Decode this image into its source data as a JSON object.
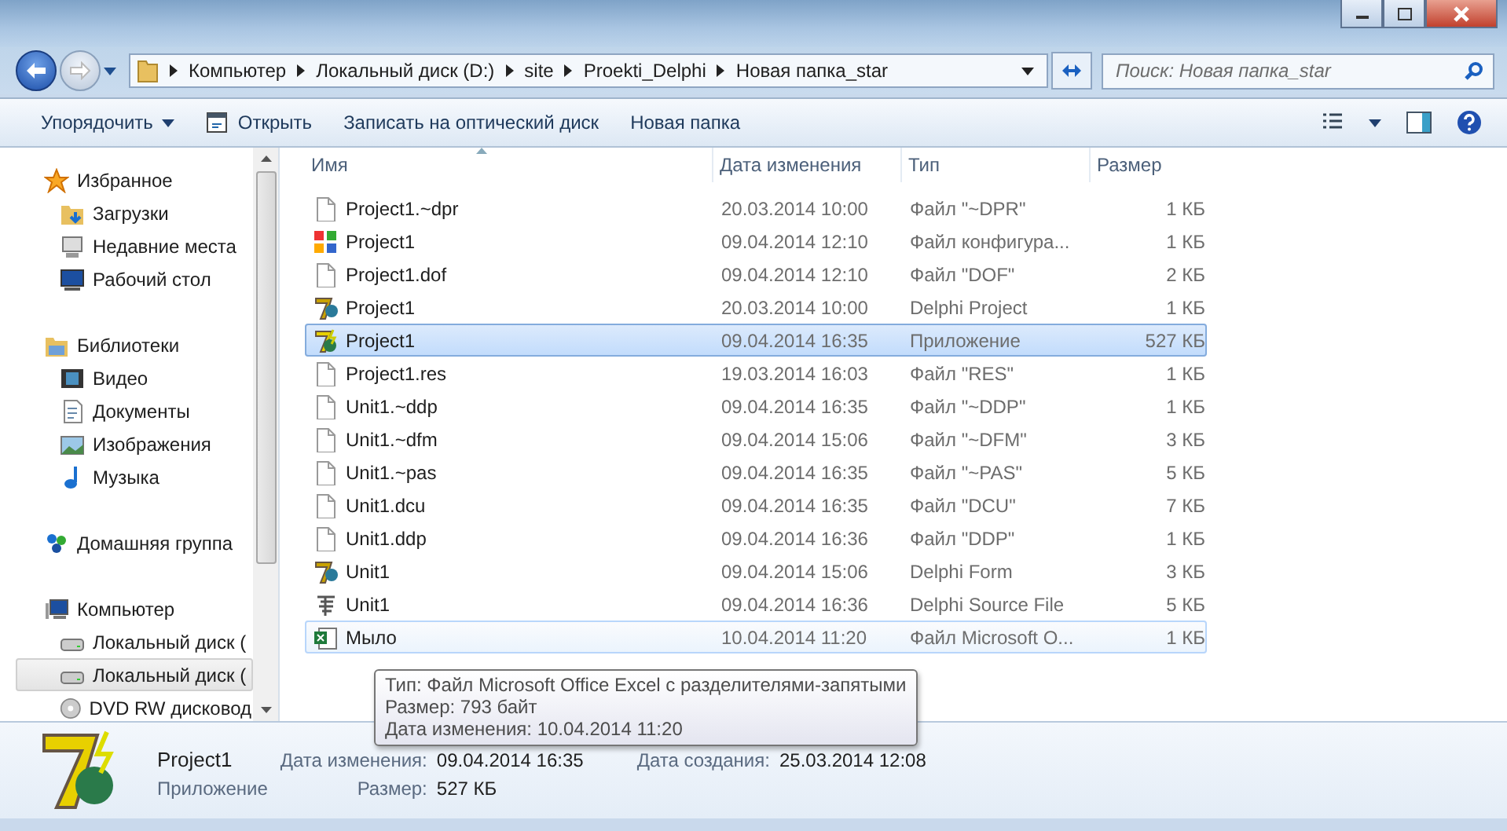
{
  "address_bar": {
    "crumbs": [
      "Компьютер",
      "Локальный диск (D:)",
      "site",
      "Proekti_Delphi",
      "Новая папка_star"
    ]
  },
  "search": {
    "placeholder": "Поиск: Новая папка_star"
  },
  "toolbar": {
    "buttons": [
      {
        "label": "Упорядочить",
        "kind": "menu"
      },
      {
        "label": "Открыть",
        "kind": "icon"
      },
      {
        "label": "Записать на оптический диск",
        "kind": "plain"
      },
      {
        "label": "Новая папка",
        "kind": "plain"
      }
    ]
  },
  "sidebar": {
    "groups": [
      {
        "label": "Избранное",
        "kind": "star",
        "selected": false,
        "children": [
          {
            "label": "Загрузки",
            "kind": "downloads",
            "selected": false
          },
          {
            "label": "Недавние места",
            "kind": "recent",
            "selected": false
          },
          {
            "label": "Рабочий стол",
            "kind": "desktop",
            "selected": false
          }
        ]
      },
      {
        "label": "Библиотеки",
        "kind": "library",
        "selected": false,
        "children": [
          {
            "label": "Видео",
            "kind": "video",
            "selected": false
          },
          {
            "label": "Документы",
            "kind": "document",
            "selected": false
          },
          {
            "label": "Изображения",
            "kind": "image",
            "selected": false
          },
          {
            "label": "Музыка",
            "kind": "music",
            "selected": false
          }
        ]
      },
      {
        "label": "Домашняя группа",
        "kind": "homegroup",
        "selected": false
      },
      {
        "label": "Компьютер",
        "kind": "computer",
        "selected": false,
        "children": [
          {
            "label": "Локальный диск (",
            "kind": "drive",
            "selected": false
          },
          {
            "label": "Локальный диск (",
            "kind": "drive",
            "selected": true
          },
          {
            "label": "DVD RW дисковод",
            "kind": "dvd",
            "selected": false
          }
        ]
      }
    ]
  },
  "table": {
    "columns": [
      "Имя",
      "Дата изменения",
      "Тип",
      "Размер"
    ],
    "rows": [
      {
        "name": "Project1.~dpr",
        "date": "20.03.2014 10:00",
        "type": "Файл \"~DPR\"",
        "size": "1 КБ",
        "kind": "blank",
        "selected": false,
        "hovered": false
      },
      {
        "name": "Project1",
        "date": "09.04.2014 12:10",
        "type": "Файл конфигура...",
        "size": "1 КБ",
        "kind": "config",
        "selected": false,
        "hovered": false
      },
      {
        "name": "Project1.dof",
        "date": "09.04.2014 12:10",
        "type": "Файл \"DOF\"",
        "size": "2 КБ",
        "kind": "blank",
        "selected": false,
        "hovered": false
      },
      {
        "name": "Project1",
        "date": "20.03.2014 10:00",
        "type": "Delphi Project",
        "size": "1 КБ",
        "kind": "delphi",
        "selected": false,
        "hovered": false
      },
      {
        "name": "Project1",
        "date": "09.04.2014 16:35",
        "type": "Приложение",
        "size": "527 КБ",
        "kind": "app",
        "selected": true,
        "hovered": false
      },
      {
        "name": "Project1.res",
        "date": "19.03.2014 16:03",
        "type": "Файл \"RES\"",
        "size": "1 КБ",
        "kind": "blank",
        "selected": false,
        "hovered": false
      },
      {
        "name": "Unit1.~ddp",
        "date": "09.04.2014 16:35",
        "type": "Файл \"~DDP\"",
        "size": "1 КБ",
        "kind": "blank",
        "selected": false,
        "hovered": false
      },
      {
        "name": "Unit1.~dfm",
        "date": "09.04.2014 15:06",
        "type": "Файл \"~DFM\"",
        "size": "3 КБ",
        "kind": "blank",
        "selected": false,
        "hovered": false
      },
      {
        "name": "Unit1.~pas",
        "date": "09.04.2014 16:35",
        "type": "Файл \"~PAS\"",
        "size": "5 КБ",
        "kind": "blank",
        "selected": false,
        "hovered": false
      },
      {
        "name": "Unit1.dcu",
        "date": "09.04.2014 16:35",
        "type": "Файл \"DCU\"",
        "size": "7 КБ",
        "kind": "blank",
        "selected": false,
        "hovered": false
      },
      {
        "name": "Unit1.ddp",
        "date": "09.04.2014 16:36",
        "type": "Файл \"DDP\"",
        "size": "1 КБ",
        "kind": "blank",
        "selected": false,
        "hovered": false
      },
      {
        "name": "Unit1",
        "date": "09.04.2014 15:06",
        "type": "Delphi Form",
        "size": "3 КБ",
        "kind": "delphi",
        "selected": false,
        "hovered": false
      },
      {
        "name": "Unit1",
        "date": "09.04.2014 16:36",
        "type": "Delphi Source File",
        "size": "5 КБ",
        "kind": "source",
        "selected": false,
        "hovered": false
      },
      {
        "name": "Мыло",
        "date": "10.04.2014 11:20",
        "type": "Файл Microsoft O...",
        "size": "1 КБ",
        "kind": "excel",
        "selected": false,
        "hovered": true
      }
    ]
  },
  "tooltip": {
    "lines": [
      "Тип: Файл Microsoft Office Excel с разделителями-запятыми",
      "Размер: 793 байт",
      "Дата изменения: 10.04.2014 11:20"
    ]
  },
  "details": {
    "name": "Project1",
    "type": "Приложение",
    "fields": [
      {
        "label": "Дата изменения:",
        "value": "09.04.2014 16:35"
      },
      {
        "label": "Дата создания:",
        "value": "25.03.2014 12:08"
      },
      {
        "label": "Размер:",
        "value": "527 КБ"
      }
    ]
  }
}
